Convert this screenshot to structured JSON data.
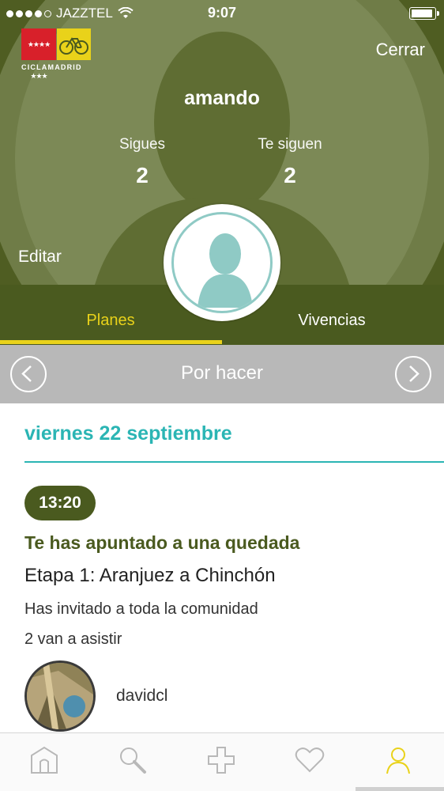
{
  "status_bar": {
    "carrier": "JAZZTEL",
    "time": "9:07",
    "battery_level": 0.95
  },
  "logo": {
    "text": "CICLAMADRID",
    "stars": "★★★★ ★★★"
  },
  "header": {
    "close_label": "Cerrar",
    "username": "amando",
    "following_label": "Sigues",
    "following_count": "2",
    "followers_label": "Te siguen",
    "followers_count": "2",
    "edit_label": "Editar"
  },
  "tabs": [
    {
      "label": "Planes",
      "active": true
    },
    {
      "label": "Vivencias",
      "active": false
    }
  ],
  "filter": {
    "title": "Por hacer"
  },
  "agenda": {
    "date_heading": "viernes 22 septiembre",
    "event": {
      "time": "13:20",
      "type": "Te has apuntado a una quedada",
      "title": "Etapa 1: Aranjuez a Chinchón",
      "invitation": "Has invitado a toda la comunidad",
      "attendance": "2 van a asistir",
      "attendee_name": "davidcl"
    }
  },
  "bottom_nav": [
    {
      "icon": "home-icon",
      "active": false
    },
    {
      "icon": "search-icon",
      "active": false
    },
    {
      "icon": "plus-icon",
      "active": false
    },
    {
      "icon": "heart-icon",
      "active": false
    },
    {
      "icon": "profile-icon",
      "active": true
    }
  ],
  "colors": {
    "header_bg": "#4a5a1f",
    "accent_yellow": "#e9d21a",
    "accent_teal": "#2bb5b4",
    "filter_bar": "#b8b8b8"
  }
}
